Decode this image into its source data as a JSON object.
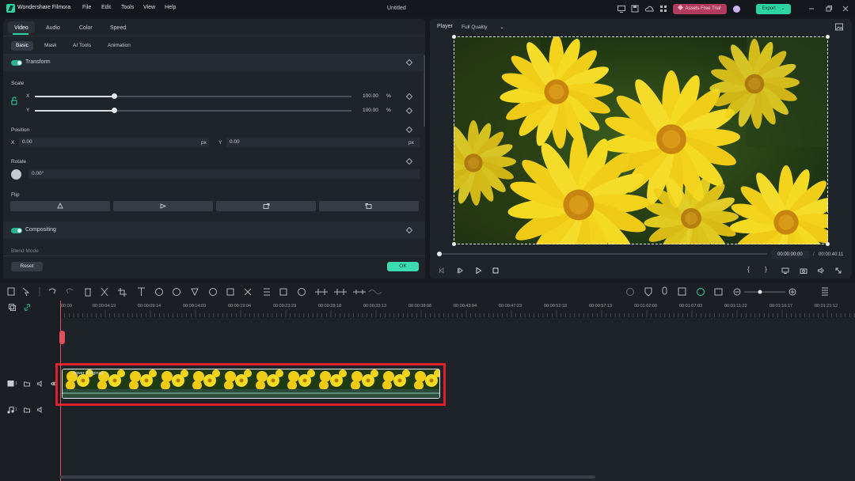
{
  "app": {
    "name": "Wondershare Filmora",
    "title": "Untitled",
    "menu": [
      "File",
      "Edit",
      "Tools",
      "View",
      "Help"
    ],
    "assets_button": "Assets Free Trial",
    "export_button": "Export"
  },
  "props": {
    "tabs": [
      "Video",
      "Audio",
      "Color",
      "Speed"
    ],
    "subtabs": [
      "Basic",
      "Mask",
      "AI Tools",
      "Animation"
    ],
    "transform_label": "Transform",
    "scale_label": "Scale",
    "scale": {
      "x_label": "X",
      "y_label": "Y",
      "x_value": "100.00",
      "y_value": "100.00",
      "unit": "%",
      "x_level": 1.0,
      "y_level": 1.0
    },
    "position_label": "Position",
    "position": {
      "x_label": "X",
      "x_value": "0.00",
      "y_label": "Y",
      "y_value": "0.00",
      "unit": "px"
    },
    "rotate_label": "Rotate",
    "rotate_value": "0.00°",
    "flip_label": "Flip",
    "compositing_label": "Compositing",
    "blend_mode_label": "Blend Mode",
    "reset_button": "Reset",
    "ok_button": "OK"
  },
  "player": {
    "label": "Player",
    "quality": "Full Quality",
    "current_time": "00:00:00:00",
    "separator": "/",
    "total_time": "00:00:40:11"
  },
  "timeline": {
    "ruler": [
      "00:00",
      "00:00:04:19",
      "00:00:09:14",
      "00:00:14:09",
      "00:00:19:04",
      "00:00:23:23",
      "00:00:28:18",
      "00:00:33:13",
      "00:00:38:08",
      "00:00:43:04",
      "00:00:47:23",
      "00:00:52:18",
      "00:00:57:13",
      "00:01:02:08",
      "00:01:07:03",
      "00:01:11:22",
      "00:01:16:17",
      "00:01:21:12"
    ],
    "video_track_num": "1",
    "audio_track_num": "1",
    "clip_label": "flower (Original)"
  },
  "colors": {
    "accent": "#2ed3a4",
    "highlight": "#e0202c",
    "playhead": "#e0505a"
  }
}
